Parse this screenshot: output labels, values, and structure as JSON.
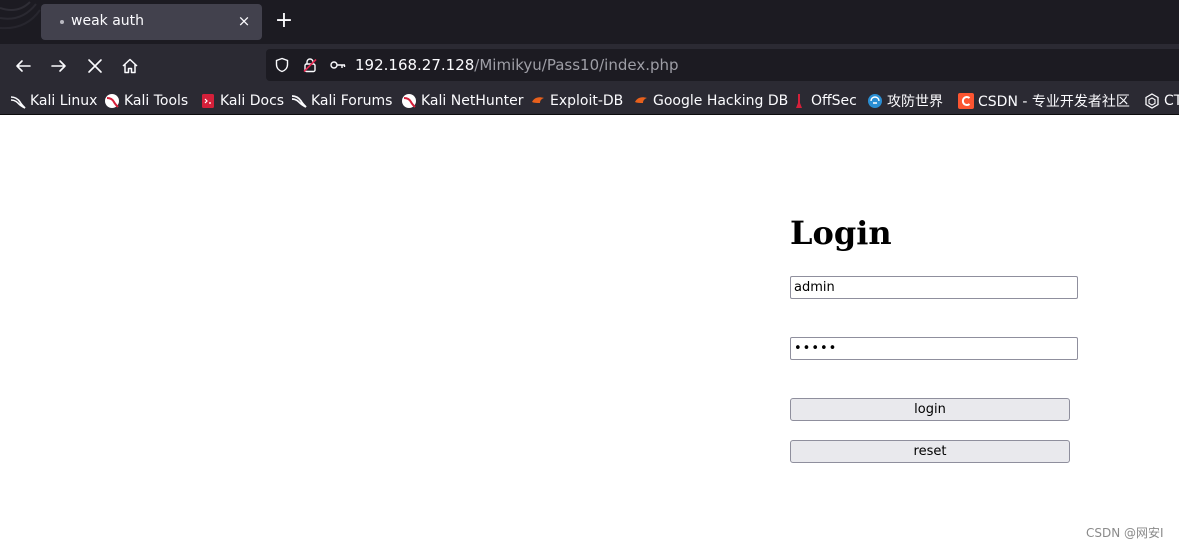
{
  "browser": {
    "tab": {
      "title": "weak auth",
      "close": "×"
    },
    "new_tab": "+",
    "url": {
      "host": "192.168.27.128",
      "path": "/Mimikyu/Pass10/index.php"
    }
  },
  "bookmarks": [
    {
      "label": "Kali Linux",
      "icon": "kali-dragon-icon"
    },
    {
      "label": "Kali Tools",
      "icon": "kali-tools-icon"
    },
    {
      "label": "Kali Docs",
      "icon": "kali-docs-icon"
    },
    {
      "label": "Kali Forums",
      "icon": "kali-forums-icon"
    },
    {
      "label": "Kali NetHunter",
      "icon": "kali-nethunter-icon"
    },
    {
      "label": "Exploit-DB",
      "icon": "exploit-db-icon"
    },
    {
      "label": "Google Hacking DB",
      "icon": "ghdb-icon"
    },
    {
      "label": "OffSec",
      "icon": "offsec-icon"
    },
    {
      "label": "攻防世界",
      "icon": "adworld-icon"
    },
    {
      "label": "CSDN - 专业开发者社区",
      "icon": "csdn-icon"
    },
    {
      "label": "CT",
      "icon": "ctf-icon"
    }
  ],
  "page": {
    "heading": "Login",
    "username_value": "admin",
    "password_value": "•••••",
    "login_label": "login",
    "reset_label": "reset"
  },
  "watermark": "CSDN @网安I",
  "colors": {
    "tabstrip_bg": "#1c1b22",
    "toolbar_bg": "#2b2a33",
    "active_tab_bg": "#42414d",
    "urlbar_bg": "#1c1b22",
    "button_bg": "#e9e9ed"
  }
}
